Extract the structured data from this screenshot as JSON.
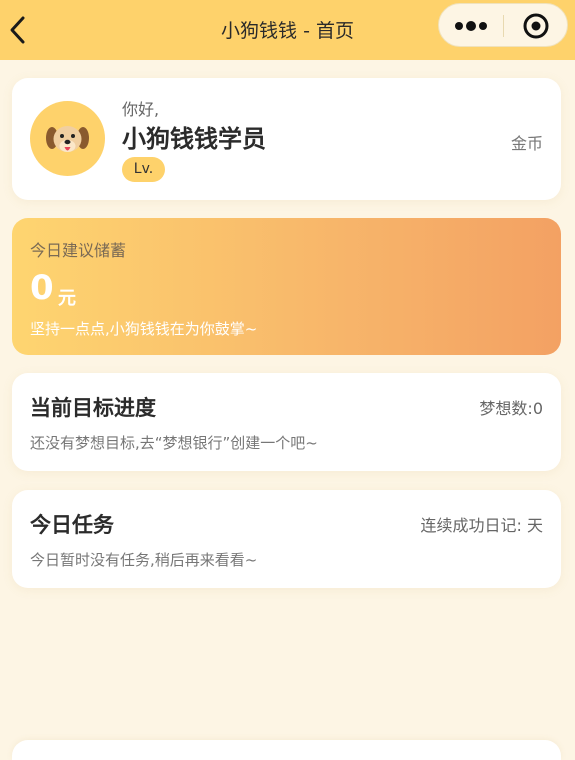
{
  "nav": {
    "title": "小狗钱钱 - 首页",
    "back_icon": "chevron-left-icon",
    "more_icon": "more-dots-icon",
    "close_icon": "target-circle-icon",
    "bg_color": "#FED26B"
  },
  "profile": {
    "greeting": "你好,",
    "name": "小狗钱钱学员",
    "level": "Lv.",
    "coin_label": "金币",
    "avatar_icon": "dog-avatar-icon"
  },
  "savings": {
    "label": "今日建议储蓄",
    "amount": "0",
    "unit": "元",
    "note": "坚持一点点,小狗钱钱在为你鼓掌~"
  },
  "goal": {
    "title": "当前目标进度",
    "count_label": "梦想数:0",
    "empty_text": "还没有梦想目标,去“梦想银行”创建一个吧~"
  },
  "task": {
    "title": "今日任务",
    "streak_label": "连续成功日记: 天",
    "empty_text": "今日暂时没有任务,稍后再来看看~"
  },
  "colors": {
    "background": "#FDF5E4",
    "accent": "#FED26B",
    "gradient_end": "#F3A163"
  }
}
